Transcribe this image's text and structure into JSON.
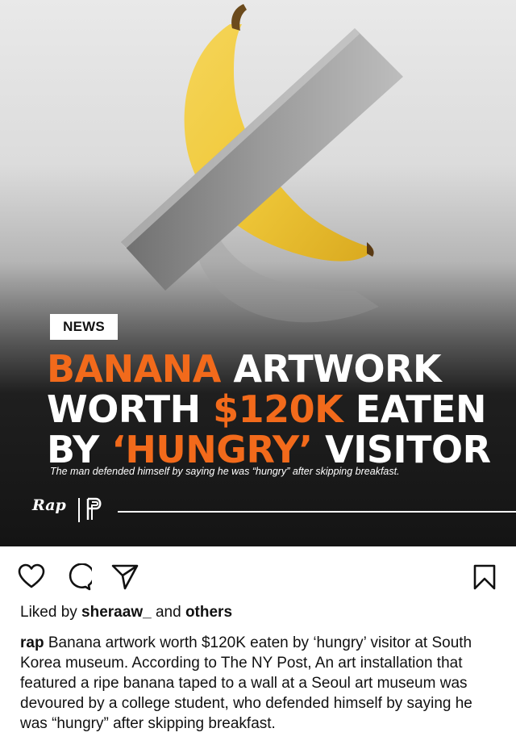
{
  "post": {
    "tag": "NEWS",
    "headline": {
      "line1_accent": "BANANA",
      "line1_rest": " ARTWORK",
      "line2_pre": "WORTH ",
      "line2_accent": "$120K",
      "line2_post": " EATEN",
      "line3_pre": "BY ",
      "line3_accent": "‘HUNGRY’",
      "line3_post": " VISITOR"
    },
    "subhead": "The man defended himself by saying he was “hungry” after skipping breakfast.",
    "brand_logo_text": "Rap",
    "accent_color": "#f26a1b"
  },
  "actions": {
    "like_icon": "heart-icon",
    "comment_icon": "comment-icon",
    "share_icon": "share-icon",
    "save_icon": "bookmark-icon"
  },
  "likes": {
    "prefix": "Liked by ",
    "user": "sheraaw_",
    "middle": " and ",
    "suffix": "others"
  },
  "caption": {
    "username": "rap",
    "text": " Banana artwork worth $120K eaten by ‘hungry’ visitor at South Korea museum. According to The NY Post, An art installation that featured a ripe banana taped to a wall at a Seoul art museum was devoured by a college student, who defended himself by saying he was “hungry” after skipping breakfast."
  }
}
